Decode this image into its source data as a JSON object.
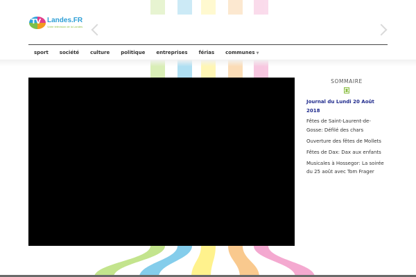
{
  "header": {
    "logo": {
      "badge": "TV",
      "name": "Landes.FR",
      "tagline": "Votre télévision de la Landes",
      "colors": [
        "#e23c8a",
        "#f39a1e",
        "#7cc04a",
        "#2ea3dc"
      ]
    },
    "carousel": {
      "prev_icon": "chevron-left-icon",
      "next_icon": "chevron-right-icon"
    }
  },
  "nav": {
    "items": [
      {
        "label": "sport"
      },
      {
        "label": "société"
      },
      {
        "label": "culture"
      },
      {
        "label": "politique"
      },
      {
        "label": "entreprises"
      },
      {
        "label": "férias"
      },
      {
        "label": "communes",
        "has_dropdown": true
      }
    ]
  },
  "player": {
    "state": "blank"
  },
  "sidebar": {
    "title": "SOMMAIRE",
    "icon": "film-strip-icon",
    "current": "Journal  du Lundi 20 Août 2018",
    "items": [
      {
        "label": "Fêtes de Saint-Laurent-de-Gosse: Défilé des chars"
      },
      {
        "label": "Ouverture des fêtes de Mollets"
      },
      {
        "label": "Fêtes de Dax: Dax aux enfants"
      },
      {
        "label": "Musicales à Hossegor: La soirée du 25 août avec Tom Frager"
      }
    ]
  },
  "background": {
    "stripe_colors": [
      "#b9e07a",
      "#6fc5e8",
      "#fff07a",
      "#f9c07b",
      "#f29ac8"
    ]
  }
}
